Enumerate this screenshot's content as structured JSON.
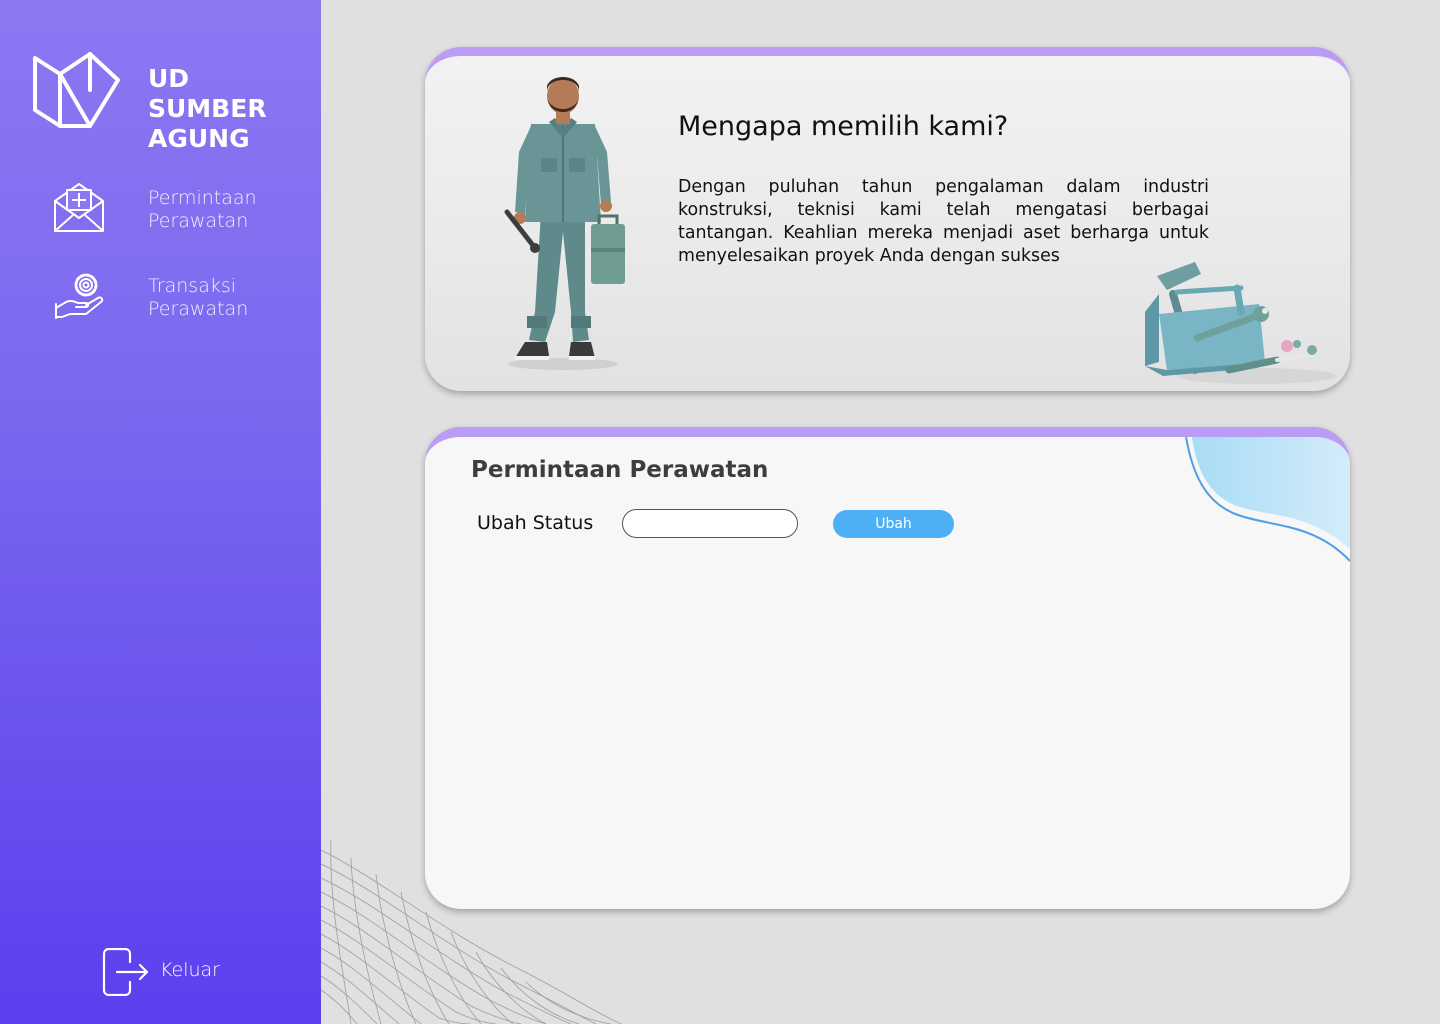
{
  "brand": {
    "name": "UD SUMBER AGUNG",
    "logo_icon": "logo-book-icon"
  },
  "sidebar": {
    "items": [
      {
        "label": "Permintaan Perawatan",
        "icon": "envelope-plus-icon"
      },
      {
        "label": "Transaksi Perawatan",
        "icon": "hand-gear-icon"
      }
    ],
    "logout": {
      "label": "Keluar",
      "icon": "logout-icon"
    }
  },
  "hero": {
    "title": "Mengapa memilih kami?",
    "text": "Dengan puluhan tahun pengalaman dalam industri konstruksi, teknisi kami telah mengatasi berbagai tantangan. Keahlian mereka menjadi aset berharga untuk menyelesaikan proyek Anda dengan sukses",
    "images": [
      "worker-illustration",
      "toolbox-illustration"
    ]
  },
  "form": {
    "title": "Permintaan Perawatan",
    "status_label": "Ubah Status",
    "status_value": "",
    "submit_label": "Ubah"
  },
  "colors": {
    "sidebar_top": "#8c78f2",
    "sidebar_bottom": "#5b3fee",
    "card_accent": "#bb9cf5",
    "button": "#4db0f5",
    "background": "#e0e0e0"
  }
}
